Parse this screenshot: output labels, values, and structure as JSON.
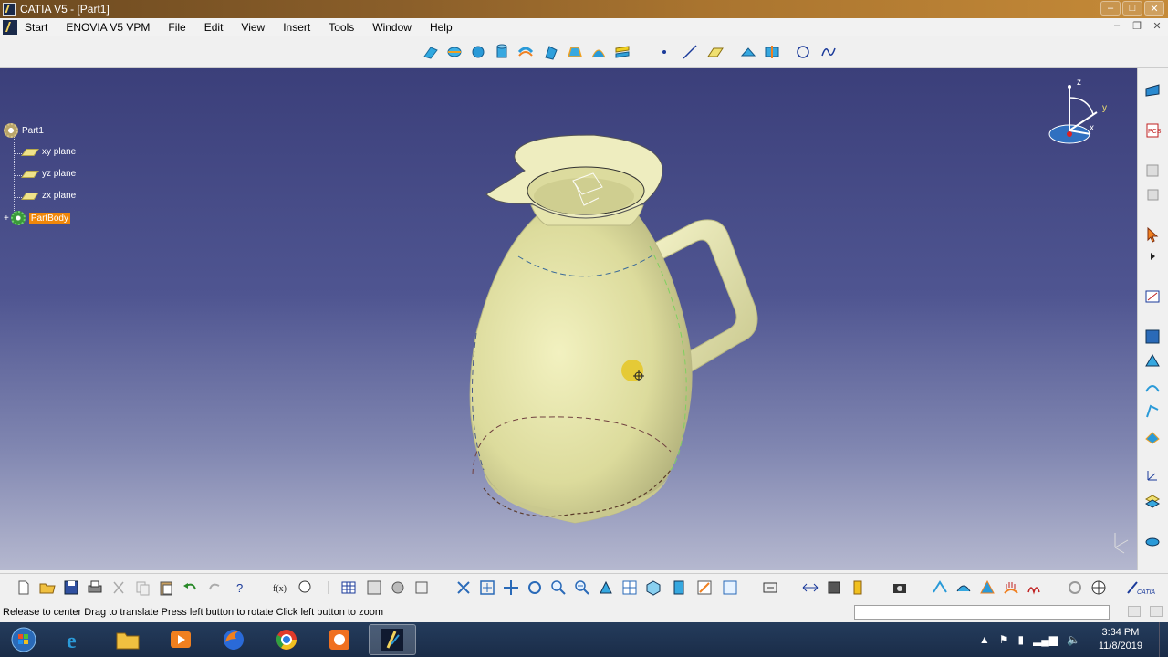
{
  "window": {
    "title": "CATIA V5 - [Part1]",
    "controls": [
      "–",
      "□",
      "✕"
    ]
  },
  "menu": {
    "items": [
      "Start",
      "ENOVIA V5 VPM",
      "File",
      "Edit",
      "View",
      "Insert",
      "Tools",
      "Window",
      "Help"
    ],
    "mdi_controls": [
      "–",
      "❐",
      "✕"
    ]
  },
  "spec_tree": {
    "root": "Part1",
    "planes": [
      "xy plane",
      "yz plane",
      "zx plane"
    ],
    "body": "PartBody"
  },
  "compass_axes": {
    "z": "z",
    "y": "y",
    "x": "x"
  },
  "status": {
    "message": "Release to center  Drag to translate  Press left button to rotate  Click left button to zoom",
    "command_value": ""
  },
  "taskbar": {
    "time": "3:34 PM",
    "date": "11/8/2019",
    "apps": [
      "start-orb",
      "internet-explorer",
      "file-explorer",
      "media-player",
      "firefox",
      "chrome",
      "orange-app",
      "catia"
    ]
  },
  "colors": {
    "viewport_top": "#3b3f7a",
    "viewport_bottom": "#b5b8cf",
    "model_fill": "#e6e5a8",
    "highlight": "#f0870a"
  }
}
